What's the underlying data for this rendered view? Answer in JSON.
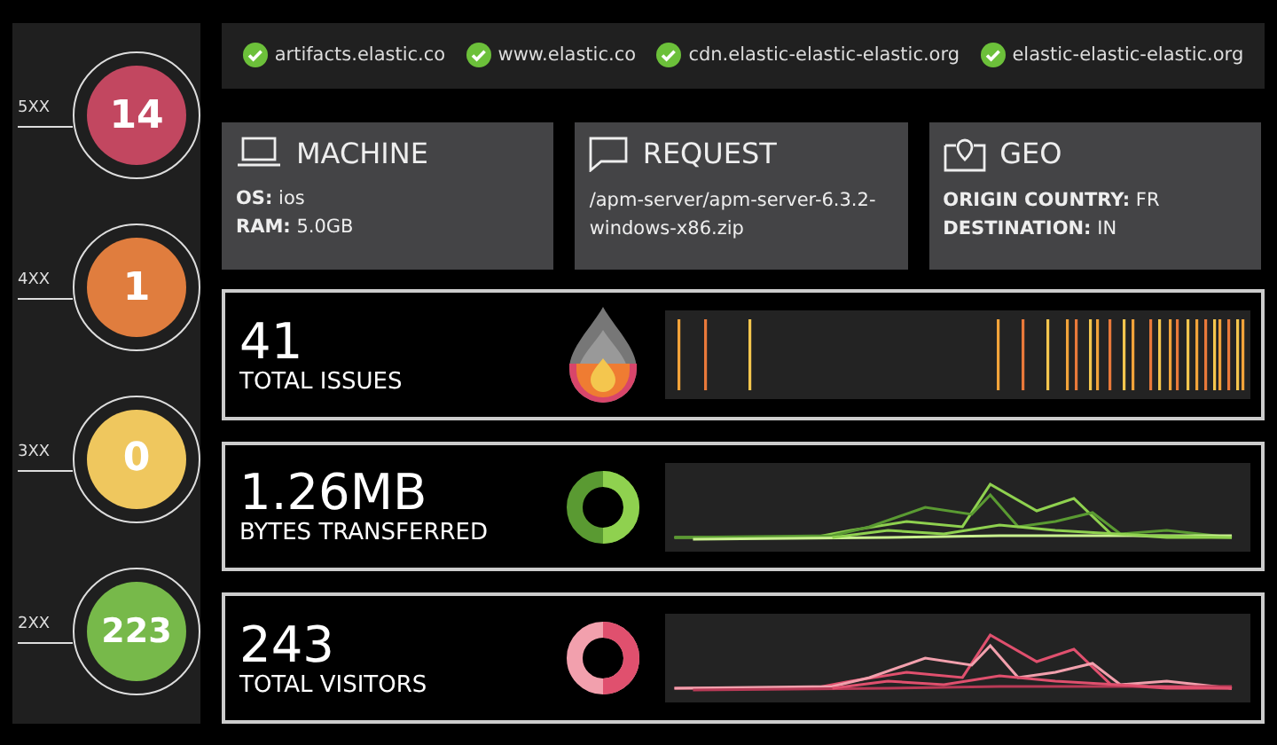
{
  "status_codes": [
    {
      "label": "5XX",
      "count": "14",
      "color": "#c24760"
    },
    {
      "label": "4XX",
      "count": "1",
      "color": "#e07d3e"
    },
    {
      "label": "3XX",
      "count": "0",
      "color": "#efc75e"
    },
    {
      "label": "2XX",
      "count": "223",
      "color": "#77b94a"
    }
  ],
  "hosts": [
    {
      "name": "artifacts.elastic.co",
      "ok": true
    },
    {
      "name": "www.elastic.co",
      "ok": true
    },
    {
      "name": "cdn.elastic-elastic-elastic.org",
      "ok": true
    },
    {
      "name": "elastic-elastic-elastic.org",
      "ok": true
    }
  ],
  "cards": [
    {
      "kind": "machine",
      "title": "MACHINE",
      "lines": [
        "**OS:** ios",
        "**RAM:** 5.0GB"
      ]
    },
    {
      "kind": "request",
      "title": "REQUEST",
      "lines": [
        "/apm-server/apm-server-6.3.2-windows-x86.zip"
      ]
    },
    {
      "kind": "geo",
      "title": "GEO",
      "lines": [
        "**ORIGIN COUNTRY:** FR",
        "**DESTINATION:** IN"
      ]
    }
  ],
  "metrics": [
    {
      "kind": "issues",
      "value": "41",
      "label": "TOTAL ISSUES"
    },
    {
      "kind": "bytes",
      "value": "1.26MB",
      "label": "BYTES TRANSFERRED"
    },
    {
      "kind": "visitors",
      "value": "243",
      "label": "TOTAL VISITORS"
    }
  ]
}
